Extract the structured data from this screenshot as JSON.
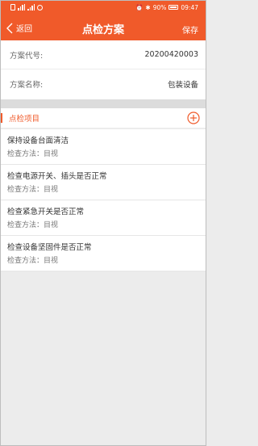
{
  "status_bar": {
    "left_icons": [
      "sim-icon",
      "signal-icon",
      "wifi-icon",
      "notification-icon"
    ],
    "battery": "90%",
    "time": "09:47"
  },
  "nav": {
    "back_label": "返回",
    "title": "点检方案",
    "save_label": "保存"
  },
  "form": {
    "code_label": "方案代号:",
    "code_value": "20200420003",
    "name_label": "方案名称:",
    "name_value": "包装设备"
  },
  "section": {
    "title": "点检项目",
    "add_icon": "plus-circle-icon"
  },
  "items": [
    {
      "name": "保持设备台面清洁",
      "method": "检查方法：目视"
    },
    {
      "name": "检查电源开关、插头是否正常",
      "method": "检查方法：目视"
    },
    {
      "name": "检查紧急开关是否正常",
      "method": "检查方法：目视"
    },
    {
      "name": "检查设备坚固件是否正常",
      "method": "检查方法：目视"
    }
  ],
  "colors": {
    "accent": "#f05a2a",
    "background": "#ececec"
  }
}
